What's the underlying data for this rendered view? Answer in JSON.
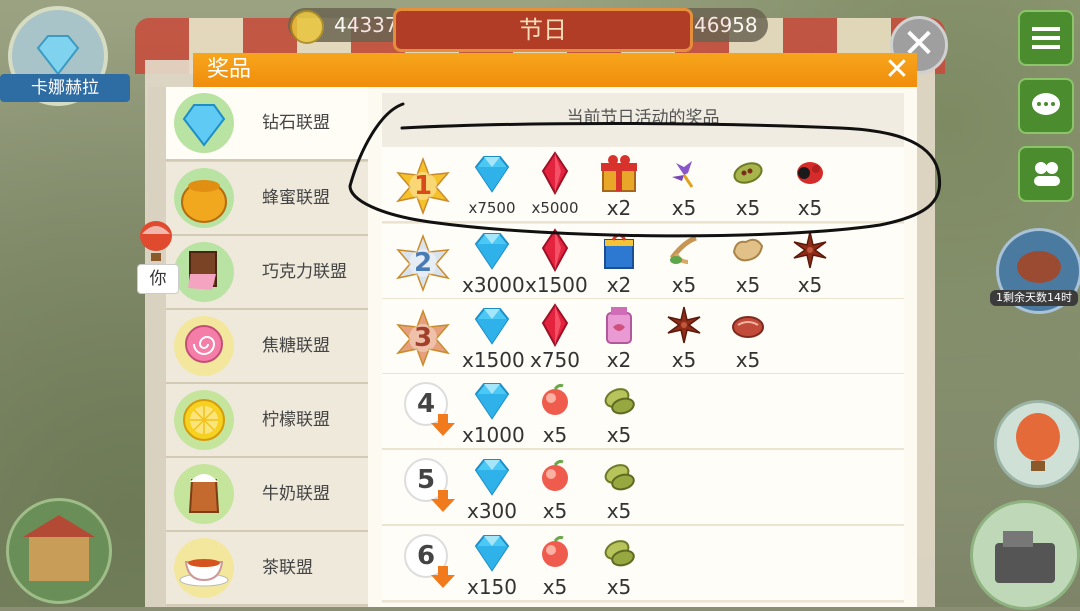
{
  "header": {
    "player_name": "卡娜赫拉",
    "coins_left": "44337",
    "festival_tab": "节日",
    "coins_right": "46958",
    "bg_close": "✕"
  },
  "dialog": {
    "title": "奖品",
    "close": "✕",
    "prize_heading": "当前节日活动的奖品"
  },
  "leagues": [
    {
      "label": "钻石联盟",
      "icon": "diamond-league-icon",
      "active": true
    },
    {
      "label": "蜂蜜联盟",
      "icon": "honey-league-icon"
    },
    {
      "label": "巧克力联盟",
      "icon": "chocolate-league-icon"
    },
    {
      "label": "焦糖联盟",
      "icon": "caramel-league-icon"
    },
    {
      "label": "柠檬联盟",
      "icon": "lemon-league-icon"
    },
    {
      "label": "牛奶联盟",
      "icon": "milk-league-icon"
    },
    {
      "label": "茶联盟",
      "icon": "tea-league-icon"
    }
  ],
  "you_marker": "你",
  "right_hud": {
    "days_left": "1剩余天数14时"
  },
  "prize_rows": [
    {
      "rank": "1",
      "items": [
        {
          "icon": "blue-diamond-icon",
          "qty": "x7500"
        },
        {
          "icon": "red-ruby-icon",
          "qty": "x5000"
        },
        {
          "icon": "gift-box-icon",
          "qty": "x2"
        },
        {
          "icon": "saffron-flower-icon",
          "qty": "x5"
        },
        {
          "icon": "cardamom-pod-icon",
          "qty": "x5"
        },
        {
          "icon": "red-seed-icon",
          "qty": "x5"
        }
      ]
    },
    {
      "rank": "2",
      "items": [
        {
          "icon": "blue-diamond-icon",
          "qty": "x3000"
        },
        {
          "icon": "red-ruby-icon",
          "qty": "x1500"
        },
        {
          "icon": "gift-bag-icon",
          "qty": "x2"
        },
        {
          "icon": "herb-root-icon",
          "qty": "x5"
        },
        {
          "icon": "ginger-icon",
          "qty": "x5"
        },
        {
          "icon": "star-anise-icon",
          "qty": "x5"
        }
      ]
    },
    {
      "rank": "3",
      "items": [
        {
          "icon": "blue-diamond-icon",
          "qty": "x1500"
        },
        {
          "icon": "red-ruby-icon",
          "qty": "x750"
        },
        {
          "icon": "pink-bag-icon",
          "qty": "x2"
        },
        {
          "icon": "star-anise-icon",
          "qty": "x5"
        },
        {
          "icon": "meat-icon",
          "qty": "x5"
        }
      ]
    },
    {
      "rank": "4",
      "items": [
        {
          "icon": "blue-diamond-icon",
          "qty": "x1000"
        },
        {
          "icon": "peach-icon",
          "qty": "x5"
        },
        {
          "icon": "cardamom-icon",
          "qty": "x5"
        }
      ]
    },
    {
      "rank": "5",
      "items": [
        {
          "icon": "blue-diamond-icon",
          "qty": "x300"
        },
        {
          "icon": "peach-icon",
          "qty": "x5"
        },
        {
          "icon": "cardamom-icon",
          "qty": "x5"
        }
      ]
    },
    {
      "rank": "6",
      "items": [
        {
          "icon": "blue-diamond-icon",
          "qty": "x150"
        },
        {
          "icon": "peach-icon",
          "qty": "x5"
        },
        {
          "icon": "cardamom-icon",
          "qty": "x5"
        }
      ]
    }
  ],
  "colors": {
    "header_orange": "#f39a14",
    "diamond_blue": "#3fc0f2",
    "ruby_red": "#e0203a",
    "annotation": "#111111"
  }
}
